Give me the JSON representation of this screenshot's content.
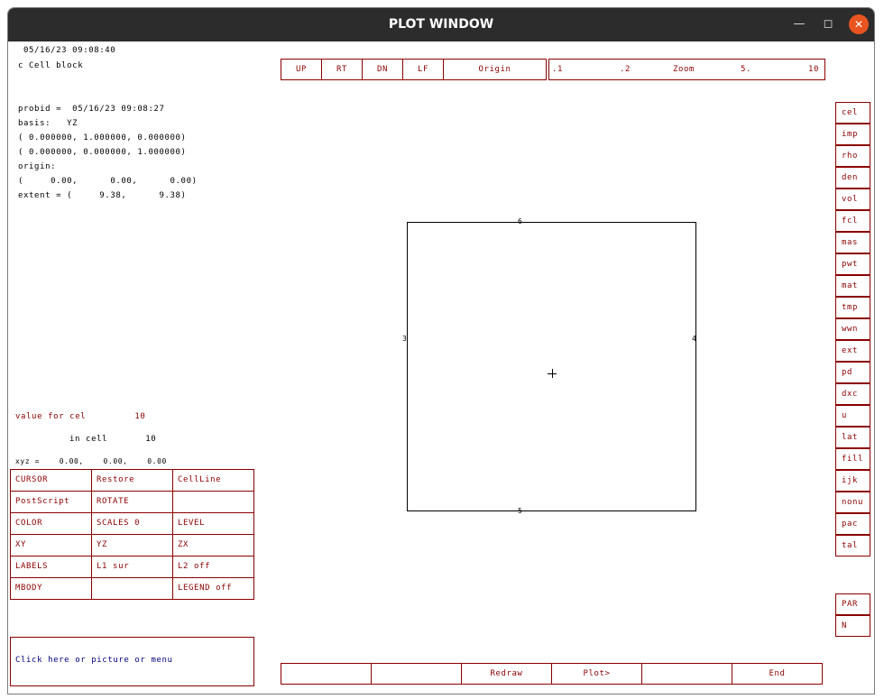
{
  "window": {
    "title": "PLOT WINDOW",
    "minimize_icon": "minimize-icon",
    "maximize_icon": "maximize-icon",
    "close_icon": "close-icon"
  },
  "header": {
    "timestamp": "05/16/23 09:08:40",
    "comment": "c Cell block"
  },
  "info": {
    "probid": "probid =  05/16/23 09:08:27",
    "basis": "basis:   YZ",
    "basis_v1": "( 0.000000, 1.000000, 0.000000)",
    "basis_v2": "( 0.000000, 0.000000, 1.000000)",
    "origin_label": "origin:",
    "origin_value": "(     0.00,      0.00,      0.00)",
    "extent": "extent = (     9.38,      9.38)"
  },
  "readout": {
    "value_for": "value for cel         10",
    "in_cell": "in cell       10",
    "xyz": "xyz =    0.00,    0.00,    0.00"
  },
  "topnav": {
    "up": "UP",
    "rt": "RT",
    "dn": "DN",
    "lf": "LF",
    "origin": "Origin"
  },
  "zoombar": {
    "z1": ".1",
    "z2": ".2",
    "zoom": "Zoom",
    "z5": "5.",
    "z10": "10"
  },
  "menu": [
    [
      "CURSOR",
      "Restore",
      "CellLine"
    ],
    [
      "PostScript",
      "ROTATE",
      ""
    ],
    [
      "COLOR",
      "SCALES 0",
      "LEVEL"
    ],
    [
      "XY",
      "YZ",
      "ZX"
    ],
    [
      "LABELS",
      "L1 sur",
      "L2 off"
    ],
    [
      "MBODY",
      "",
      "LEGEND off"
    ]
  ],
  "sidebar": [
    "cel",
    "imp",
    "rho",
    "den",
    "vol",
    "fcl",
    "mas",
    "pwt",
    "mat",
    "tmp",
    "wwn",
    "ext",
    "pd",
    "dxc",
    "u",
    "lat",
    "fill",
    "ijk",
    "nonu",
    "pac",
    "tal"
  ],
  "sidebar2": [
    "PAR",
    "N"
  ],
  "plot": {
    "top_label": "6",
    "bottom_label": "5",
    "left_label": "3",
    "right_label": "4"
  },
  "status": {
    "prompt": "Click here or picture or menu"
  },
  "bottombar": {
    "b1": "",
    "b2": "",
    "redraw": "Redraw",
    "plot": "Plot>",
    "b5": "",
    "end": "End"
  },
  "colors": {
    "menu_border": "#8b0000",
    "menu_text": "#8b0000",
    "inactive_text": "#4a6a8a",
    "prompt_text": "#000080",
    "titlebar": "#2c2c2c",
    "close_button": "#e95420"
  }
}
